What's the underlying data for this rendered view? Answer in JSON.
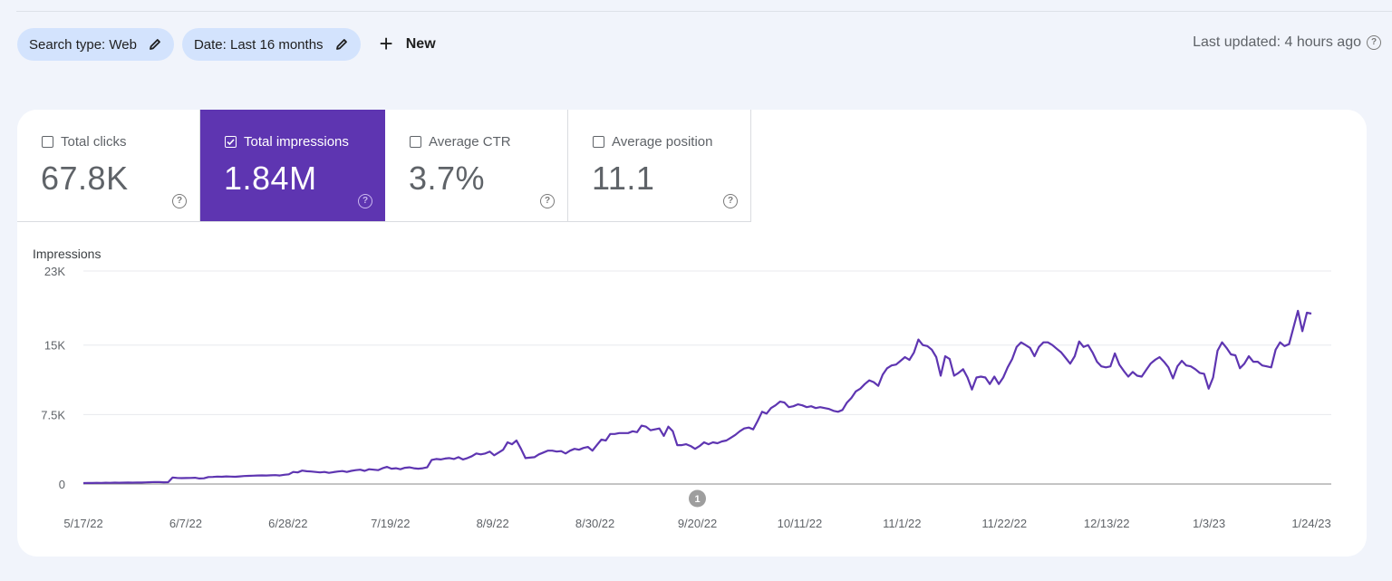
{
  "filters": {
    "chips": [
      {
        "label": "Search type: Web",
        "icon": "pencil-icon"
      },
      {
        "label": "Date: Last 16 months",
        "icon": "pencil-icon"
      }
    ],
    "new_button": {
      "label": "New",
      "icon": "plus-icon"
    }
  },
  "status": {
    "last_updated": "Last updated: 4 hours ago",
    "icon": "help-icon"
  },
  "metrics": [
    {
      "label": "Total clicks",
      "value": "67.8K",
      "checked": false
    },
    {
      "label": "Total impressions",
      "value": "1.84M",
      "checked": true
    },
    {
      "label": "Average CTR",
      "value": "3.7%",
      "checked": false
    },
    {
      "label": "Average position",
      "value": "11.1",
      "checked": false
    }
  ],
  "colors": {
    "accent": "#5e35b1",
    "line": "#5e35b1",
    "chip_bg": "#d3e3fd",
    "page_bg": "#f1f4fb"
  },
  "chart_data": {
    "type": "line",
    "title": "",
    "ylabel": "Impressions",
    "xlabel": "",
    "ylim": [
      0,
      23000
    ],
    "yticks": [
      {
        "value": 0,
        "label": "0"
      },
      {
        "value": 7500,
        "label": "7.5K"
      },
      {
        "value": 15000,
        "label": "15K"
      },
      {
        "value": 23000,
        "label": "23K"
      }
    ],
    "xticks": [
      "5/17/22",
      "6/7/22",
      "6/28/22",
      "7/19/22",
      "8/9/22",
      "8/30/22",
      "9/20/22",
      "10/11/22",
      "11/1/22",
      "11/22/22",
      "12/13/22",
      "1/3/23",
      "1/24/23"
    ],
    "x_start": "5/17/22",
    "x_end": "1/24/23",
    "grid": true,
    "legend": "none",
    "annotations": [
      {
        "date": "9/20/22",
        "label": "1"
      }
    ],
    "series": [
      {
        "name": "Total impressions",
        "values": [
          100,
          120,
          110,
          130,
          120,
          140,
          130,
          150,
          140,
          150,
          160,
          150,
          170,
          160,
          180,
          200,
          220,
          210,
          190,
          200,
          700,
          660,
          640,
          650,
          660,
          680,
          600,
          620,
          750,
          760,
          800,
          780,
          820,
          800,
          780,
          820,
          860,
          880,
          900,
          920,
          930,
          920,
          940,
          960,
          920,
          1000,
          1050,
          1300,
          1250,
          1450,
          1380,
          1350,
          1300,
          1250,
          1300,
          1200,
          1280,
          1350,
          1400,
          1300,
          1420,
          1500,
          1550,
          1420,
          1600,
          1550,
          1500,
          1700,
          1850,
          1650,
          1700,
          1600,
          1750,
          1800,
          1700,
          1650,
          1700,
          1800,
          2600,
          2700,
          2650,
          2750,
          2800,
          2700,
          2900,
          2650,
          2800,
          3000,
          3300,
          3200,
          3300,
          3500,
          3100,
          3400,
          3700,
          4500,
          4300,
          4700,
          3800,
          2800,
          2850,
          2900,
          3200,
          3400,
          3600,
          3600,
          3500,
          3550,
          3300,
          3600,
          3800,
          3700,
          3900,
          4000,
          3600,
          4200,
          4800,
          4700,
          5400,
          5400,
          5500,
          5500,
          5500,
          5700,
          5600,
          6300,
          6200,
          5800,
          5900,
          6000,
          5200,
          6200,
          5700,
          4200,
          4200,
          4300,
          4100,
          3800,
          4100,
          4500,
          4300,
          4500,
          4400,
          4600,
          4700,
          5000,
          5300,
          5700,
          6000,
          6100,
          5900,
          6800,
          7800,
          7600,
          8200,
          8500,
          8900,
          8800,
          8300,
          8400,
          8600,
          8500,
          8300,
          8400,
          8200,
          8300,
          8200,
          8100,
          7900,
          7800,
          8000,
          8800,
          9300,
          10000,
          10300,
          10800,
          11200,
          11000,
          10600,
          11800,
          12500,
          12800,
          12900,
          13300,
          13700,
          13400,
          14200,
          15600,
          15000,
          14900,
          14500,
          13700,
          11700,
          13800,
          13500,
          11700,
          12000,
          12400,
          11500,
          10200,
          11500,
          11600,
          11500,
          10800,
          11600,
          10800,
          11500,
          12600,
          13500,
          14800,
          15300,
          15000,
          14700,
          13800,
          14800,
          15300,
          15300,
          15000,
          14600,
          14200,
          13600,
          13000,
          13800,
          15400,
          14800,
          15000,
          14200,
          13200,
          12700,
          12600,
          12700,
          14100,
          12900,
          12200,
          11600,
          12100,
          11700,
          11600,
          12300,
          13000,
          13400,
          13700,
          13200,
          12600,
          11400,
          12700,
          13300,
          12800,
          12700,
          12400,
          12000,
          11900,
          10300,
          11500,
          14400,
          15300,
          14700,
          14000,
          13900,
          12500,
          13000,
          13800,
          13200,
          13200,
          12800,
          12700,
          12600,
          14500,
          15300,
          14900,
          15100,
          16900,
          18700,
          16500,
          18500,
          18400
        ]
      }
    ]
  }
}
